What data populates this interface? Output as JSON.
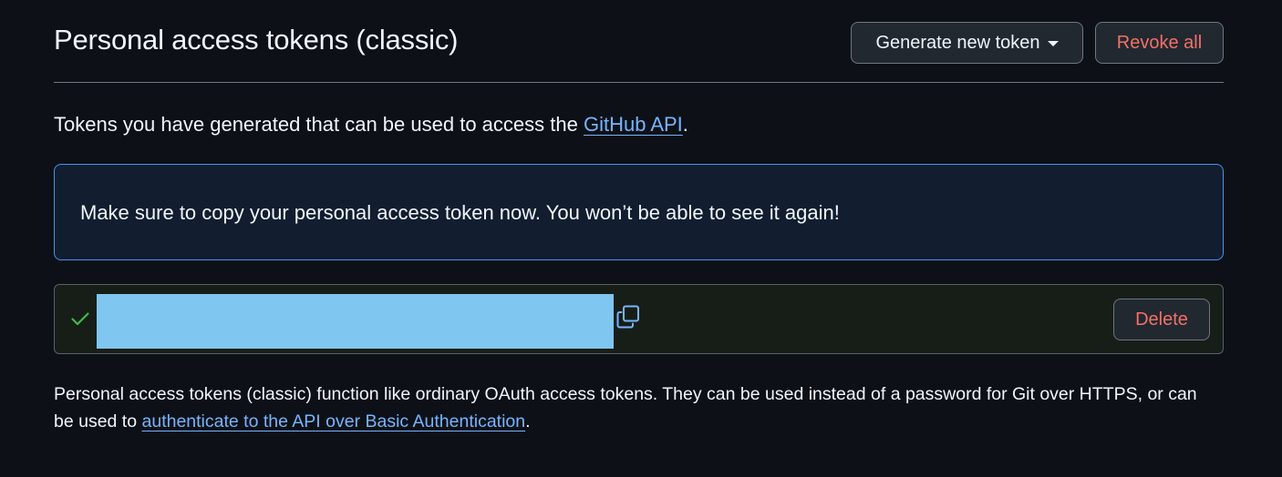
{
  "header": {
    "title": "Personal access tokens (classic)",
    "generate_label": "Generate new token",
    "revoke_label": "Revoke all"
  },
  "intro": {
    "text_before": "Tokens you have generated that can be used to access the ",
    "link_text": "GitHub API",
    "text_after": "."
  },
  "flash": {
    "message": "Make sure to copy your personal access token now. You won’t be able to see it again!"
  },
  "token": {
    "status_icon": "check-icon",
    "value": "",
    "copy_icon": "copy-icon",
    "delete_label": "Delete"
  },
  "footnote": {
    "text_before": "Personal access tokens (classic) function like ordinary OAuth access tokens. They can be used instead of a password for Git over HTTPS, or can be used to ",
    "link_text": "authenticate to the API over Basic Authentication",
    "text_after": "."
  },
  "colors": {
    "background": "#0d1117",
    "link": "#78b4ff",
    "danger": "#f47067",
    "success": "#3fb950",
    "flash_border": "#4493f8",
    "token_redaction": "#7fc6f0"
  }
}
